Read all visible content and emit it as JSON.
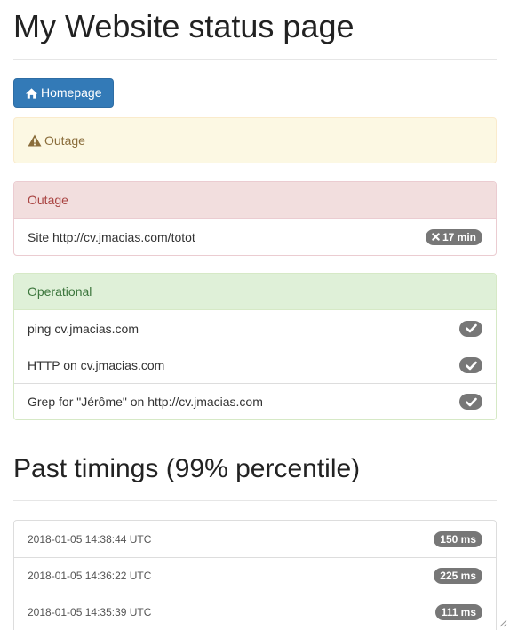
{
  "page": {
    "title": "My Website status page",
    "home_button": "Homepage",
    "alert_text": "Outage"
  },
  "outage_panel": {
    "heading": "Outage",
    "items": [
      {
        "label": "Site http://cv.jmacias.com/totot",
        "badge": "17 min",
        "icon": "times-icon"
      }
    ],
    "colors": {
      "heading_bg": "#f2dede",
      "heading_text": "#a94442"
    }
  },
  "operational_panel": {
    "heading": "Operational",
    "items": [
      {
        "label": "ping cv.jmacias.com",
        "icon": "check-icon"
      },
      {
        "label": "HTTP on cv.jmacias.com",
        "icon": "check-icon"
      },
      {
        "label": "Grep for \"Jérôme\" on http://cv.jmacias.com",
        "icon": "check-icon"
      }
    ],
    "colors": {
      "heading_bg": "#dff0d8",
      "heading_text": "#3c763d"
    }
  },
  "timings": {
    "title": "Past timings (99% percentile)",
    "rows": [
      {
        "time": "2018-01-05 14:38:44 UTC",
        "value": "150 ms"
      },
      {
        "time": "2018-01-05 14:36:22 UTC",
        "value": "225 ms"
      },
      {
        "time": "2018-01-05 14:35:39 UTC",
        "value": "111 ms"
      }
    ]
  },
  "colors": {
    "primary": "#337ab7",
    "warning_bg": "#fcf8e3",
    "warning_text": "#8a6d3b",
    "badge": "#777777"
  }
}
